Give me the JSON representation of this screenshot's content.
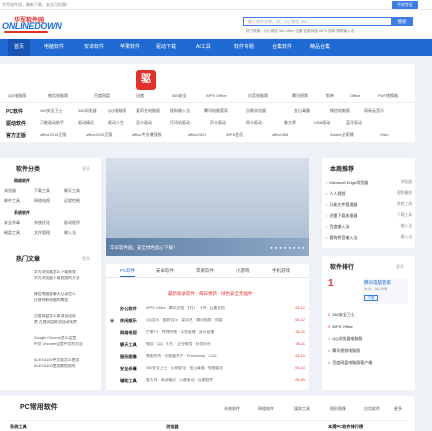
{
  "topbar": {
    "tip": "华军软件园，最新下载，安全可信赖！",
    "mobile": "手机专区"
  },
  "logo": {
    "cn": "华军软件园",
    "en": "ONLINEDOWN"
  },
  "search": {
    "placeholder": "输入软件名称，如：QQ 微信 360 ...",
    "button": "搜索"
  },
  "hot": "热门搜索：QQ 微信 360 office 迅雷 百度网盘 WPS 剪映 搜狗输入法",
  "nav": [
    "首页",
    "电脑软件",
    "安卓软件",
    "苹果软件",
    "驱动下载",
    "AI工具",
    "软件专题",
    "合集软件",
    "精品合集"
  ],
  "categories": [
    "QQ电脑版",
    "微信电脑版",
    "百度网盘",
    "迅雷",
    "360安全",
    "WPS Office",
    "抖音电脑版",
    "腾讯视频",
    "剪映",
    "Office",
    "PDF转换器"
  ],
  "keyword_rows": [
    {
      "head": "PC软件",
      "items": [
        "360安全卫士",
        "360浏览器",
        "QQ电脑版",
        "爱奇艺电脑版",
        "搜狗输入法",
        "腾讯电脑管家",
        "谷歌浏览器",
        "金山毒霸",
        "微信电脑版",
        "网易云音乐"
      ]
    },
    {
      "head": "驱动软件",
      "items": [
        "万能驱动助手",
        "驱动精灵",
        "驱动人生",
        "显卡驱动",
        "打印机驱动",
        "声卡驱动",
        "网卡驱动",
        "鲁大师",
        "USB驱动",
        "蓝牙驱动"
      ]
    },
    {
      "head": "官方正版",
      "items": [
        "office2016正版",
        "office2019正版",
        "office专业增强版",
        "office2021",
        "WPS会员",
        "office365",
        "Adobe全家桶",
        "Visio"
      ]
    }
  ],
  "software_category": {
    "title": "软件分类",
    "more": "更多",
    "groups": [
      {
        "name": "网络软件",
        "items": [
          "浏览器",
          "下载工具",
          "聊天工具",
          "邮件工具",
          "网络电视",
          "远程控制"
        ]
      },
      {
        "name": "系统软件",
        "items": [
          "安全杀毒",
          "系统优化",
          "驱动程序",
          "磁盘工具",
          "文件管理",
          "输入法"
        ]
      }
    ]
  },
  "hot_articles": {
    "title": "热门文章",
    "more": "更多",
    "items": [
      {
        "l1": "华为浏览器怎么下载视频",
        "l2": "华为浏览器下载视频的方法"
      },
      {
        "l1": "微信电脑版聊天记录怎么",
        "l2": "迁移到新电脑的教程"
      },
      {
        "l1": "百度网盘怎么取消自动续",
        "l2": "费 百度网盘取消自动续费"
      },
      {
        "l1": "Google Chrome怎么设置",
        "l2": "中文 Chrome设置中文的方法"
      },
      {
        "l1": "ALEXA100中文版怎么使用",
        "l2": "ALEXA100使用教程说明"
      }
    ]
  },
  "banner": {
    "text": "华军软件园，安全绿色放心下载！",
    "dots": "● ● ● ● ● ● ● ●"
  },
  "center_tabs": [
    "PC软件",
    "安卓软件",
    "苹果软件",
    "小游戏",
    "手机游戏"
  ],
  "rank_notice": "最新收录软件 · 每日更新 · 绿色安全无插件",
  "rank_rows": [
    {
      "cat": "办公软件",
      "items": "WPS Office · 腾讯文档 · 钉钉 · 飞书 · 石墨文档",
      "date": "06-12"
    },
    {
      "cat": "休闲娱乐",
      "items": "QQ音乐 · 酷狗音乐 · 爱奇艺 · 腾讯视频 · 优酷",
      "date": "06-12"
    },
    {
      "cat": "网络电视",
      "items": "芒果TV · 哔哩哔哩 · 斗鱼直播 · 虎牙直播",
      "date": "06-11"
    },
    {
      "cat": "聊天工具",
      "items": "微信 · QQ · 钉钉 · 企业微信 · 阿里旺旺",
      "date": "06-11"
    },
    {
      "cat": "图形图像",
      "items": "美图秀秀 · 光影魔术手 · Photoshop · CAD",
      "date": "06-10"
    },
    {
      "cat": "安全杀毒",
      "items": "360安全卫士 · 火绒安全 · 金山毒霸 · 电脑管家",
      "date": "06-10"
    },
    {
      "cat": "辅助工具",
      "items": "鲁大师 · 驱动精灵 · 万能驱动 · 压缩软件",
      "date": "06-09"
    }
  ],
  "recommend": {
    "title": "本周推荐",
    "more": "更多",
    "items": [
      {
        "name": "Microsoft Edge浏览器",
        "tag": "浏览器"
      },
      {
        "name": "人人视频",
        "tag": "视频播放"
      },
      {
        "name": "万能文件管理器",
        "tag": "系统工具"
      },
      {
        "name": "迅雷下载加速器",
        "tag": "下载工具"
      },
      {
        "name": "百度输入法",
        "tag": "输入法"
      },
      {
        "name": "搜狗拼音输入法",
        "tag": "输入法"
      }
    ]
  },
  "ranking": {
    "title": "软件排行",
    "more": "更多",
    "top": {
      "num": "1",
      "name": "腾讯电脑管家",
      "size": "大小：56.2MB",
      "button": "下载"
    },
    "items": [
      {
        "n": "2",
        "name": "360安全卫士"
      },
      {
        "n": "3",
        "name": "WPS Office"
      },
      {
        "n": "4",
        "name": "QQ浏览器电脑版"
      },
      {
        "n": "5",
        "name": "腾讯视频电脑版"
      },
      {
        "n": "6",
        "name": "百度网盘电脑版客户端"
      }
    ]
  },
  "pc_software": {
    "title": "PC常用软件",
    "tabs": [
      "系统软件",
      "网络软件",
      "媒体工具",
      "图形图像",
      "应用软件",
      "更多"
    ],
    "sub": [
      "系统工具",
      "浏览器",
      "本周PC软件排行榜"
    ]
  }
}
